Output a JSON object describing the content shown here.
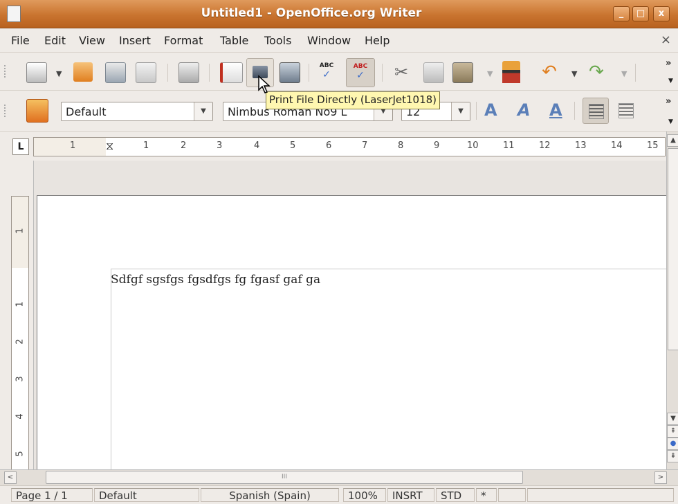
{
  "window": {
    "title": "Untitled1 - OpenOffice.org Writer",
    "controls": {
      "minimize": "_",
      "maximize": "□",
      "close": "x"
    }
  },
  "menu": {
    "items": [
      {
        "label": "File"
      },
      {
        "label": "Edit"
      },
      {
        "label": "View"
      },
      {
        "label": "Insert"
      },
      {
        "label": "Format"
      },
      {
        "label": "Table"
      },
      {
        "label": "Tools"
      },
      {
        "label": "Window"
      },
      {
        "label": "Help"
      }
    ],
    "close_doc": "×"
  },
  "standard_toolbar": {
    "icons": [
      "new-document-icon",
      "open-folder-icon",
      "save-icon",
      "email-icon",
      "edit-file-icon",
      "export-pdf-icon",
      "print-directly-icon",
      "print-preview-icon",
      "spellcheck-icon",
      "autospellcheck-icon",
      "cut-icon",
      "copy-icon",
      "paste-icon",
      "clone-format-icon",
      "undo-icon",
      "redo-icon"
    ],
    "overflow": "»"
  },
  "tooltip": {
    "text": "Print File Directly (LaserJet1018)"
  },
  "formatting_toolbar": {
    "paragraph_style": "Default",
    "font_name": "Nimbus Roman No9 L",
    "font_size": "12",
    "icons": [
      "styles-icon",
      "bold-icon",
      "italic-icon",
      "underline-icon",
      "align-left-icon",
      "align-center-icon"
    ],
    "bold_glyph": "A",
    "italic_glyph": "A",
    "underline_glyph": "A",
    "overflow": "»"
  },
  "ruler": {
    "corner": "L",
    "h_ticks": [
      "1",
      "1",
      "2",
      "3",
      "4",
      "5",
      "6",
      "7",
      "8",
      "9",
      "10",
      "11",
      "12",
      "13",
      "14",
      "15"
    ],
    "v_ticks": [
      "1",
      "1",
      "2",
      "3",
      "4",
      "5"
    ]
  },
  "document": {
    "text": "Sdfgf sgsfgs fgsdfgs fg fgasf gaf ga"
  },
  "scrollbar": {
    "left_arrow": "<",
    "right_arrow": ">",
    "thumb_grip": "III"
  },
  "statusbar": {
    "page": "Page 1 / 1",
    "style": "Default",
    "language": "Spanish (Spain)",
    "zoom": "100%",
    "insert_mode": "INSRT",
    "selection_mode": "STD",
    "modified": "*"
  }
}
